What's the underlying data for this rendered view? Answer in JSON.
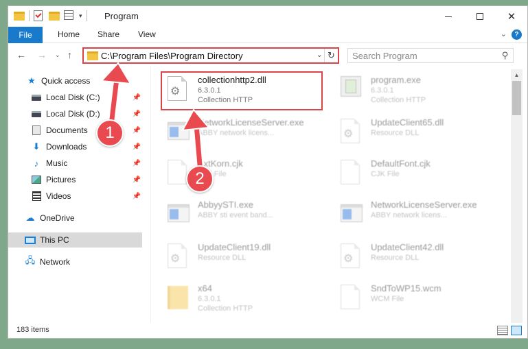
{
  "window": {
    "title": "Program",
    "controls": {
      "minimize": "—",
      "maximize": "☐",
      "close": "✕"
    }
  },
  "ribbon": {
    "file_tab": "File",
    "tabs": [
      "Home",
      "Share",
      "View"
    ],
    "help": "?"
  },
  "nav": {
    "address": "C:\\Program Files\\Program Directory",
    "search_placeholder": "Search Program"
  },
  "sidebar": {
    "items": [
      {
        "label": "Quick access",
        "icon": "star-icon",
        "pinned": false
      },
      {
        "label": "Local Disk (C:)",
        "icon": "drive-icon",
        "pinned": true
      },
      {
        "label": "Local Disk (D:)",
        "icon": "drive-icon",
        "pinned": true
      },
      {
        "label": "Documents",
        "icon": "documents-icon",
        "pinned": true
      },
      {
        "label": "Downloads",
        "icon": "download-icon",
        "pinned": true
      },
      {
        "label": "Music",
        "icon": "music-icon",
        "pinned": true
      },
      {
        "label": "Pictures",
        "icon": "pictures-icon",
        "pinned": true
      },
      {
        "label": "Videos",
        "icon": "videos-icon",
        "pinned": true
      },
      {
        "label": "OneDrive",
        "icon": "cloud-icon",
        "pinned": false
      },
      {
        "label": "This PC",
        "icon": "computer-icon",
        "pinned": false,
        "selected": true
      },
      {
        "label": "Network",
        "icon": "network-icon",
        "pinned": false
      }
    ]
  },
  "files": [
    {
      "name": "collectionhttp2.dll",
      "line1": "6.3.0.1",
      "line2": "Collection HTTP",
      "icon": "settings-file-icon",
      "highlighted": true
    },
    {
      "name": "program.exe",
      "line1": "6.3.0.1",
      "line2": "Collection HTTP",
      "icon": "program-icon"
    },
    {
      "name": "NetworkLicenseServer.exe",
      "line1": "ABBY network licens...",
      "line2": "",
      "icon": "exe-icon"
    },
    {
      "name": "UpdateClient65.dll",
      "line1": "Resource DLL",
      "line2": "",
      "icon": "settings-file-icon"
    },
    {
      "name": "ExtKorn.cjk",
      "line1": "CJK File",
      "line2": "",
      "icon": "blank-file-icon"
    },
    {
      "name": "DefaultFont.cjk",
      "line1": "CJK File",
      "line2": "",
      "icon": "blank-file-icon"
    },
    {
      "name": "AbbyySTI.exe",
      "line1": "ABBY sti event band...",
      "line2": "",
      "icon": "exe-icon"
    },
    {
      "name": "NetworkLicenseServer.exe",
      "line1": "ABBY network licens...",
      "line2": "",
      "icon": "exe-icon"
    },
    {
      "name": "UpdateClient19.dll",
      "line1": "Resource DLL",
      "line2": "",
      "icon": "settings-file-icon"
    },
    {
      "name": "UpdateClient42.dll",
      "line1": "Resource DLL",
      "line2": "",
      "icon": "settings-file-icon"
    },
    {
      "name": "x64",
      "line1": "6.3.0.1",
      "line2": "Collection HTTP",
      "icon": "folder-icon"
    },
    {
      "name": "SndToWP15.wcm",
      "line1": "WCM File",
      "line2": "",
      "icon": "blank-file-icon"
    }
  ],
  "status": {
    "item_count": "183 items"
  },
  "callouts": {
    "step1": "1",
    "step2": "2"
  },
  "colors": {
    "accent": "#1979ca",
    "callout": "#e84a4f",
    "highlight_border": "#d9434a"
  }
}
